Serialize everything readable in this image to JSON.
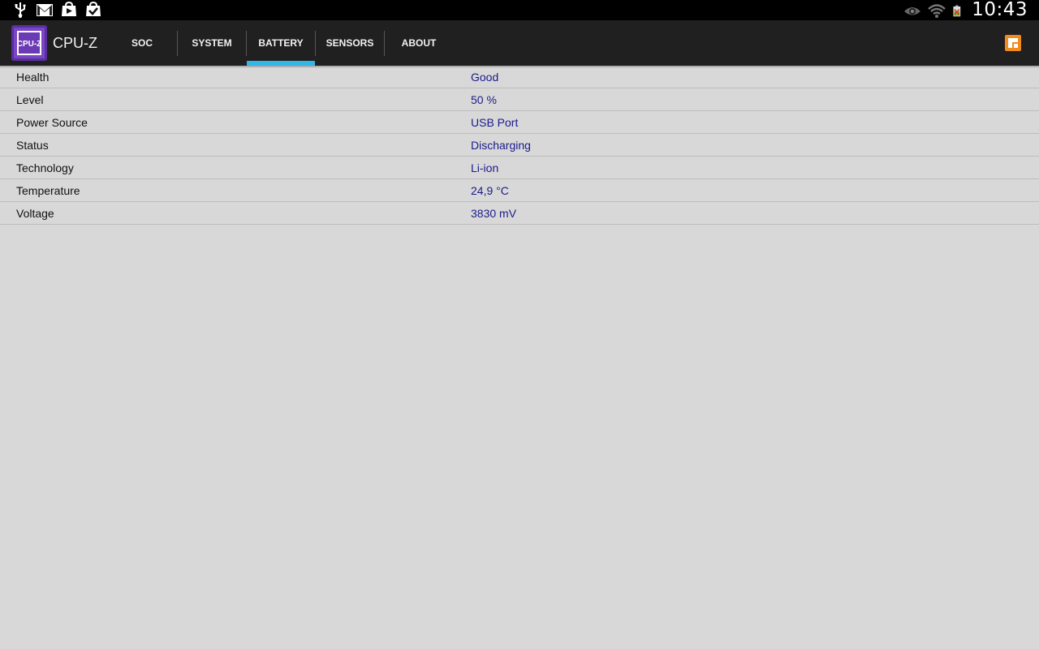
{
  "status_bar": {
    "left_icons": [
      "usb-icon",
      "gmail-icon",
      "play-store-icon",
      "task-icon"
    ],
    "right_icons": [
      "eye-icon",
      "wifi-icon",
      "battery-icon"
    ],
    "time": "10:43"
  },
  "action_bar": {
    "app_icon": "cpu-z-logo",
    "app_logo_text": "CPU-Z",
    "app_title": "CPU-Z",
    "tabs": [
      {
        "label": "SOC",
        "active": false
      },
      {
        "label": "SYSTEM",
        "active": false
      },
      {
        "label": "BATTERY",
        "active": true
      },
      {
        "label": "SENSORS",
        "active": false
      },
      {
        "label": "ABOUT",
        "active": false
      }
    ],
    "accent_color": "#33b5e5",
    "menu_icon": "overflow-menu-icon"
  },
  "battery": {
    "rows": [
      {
        "label": "Health",
        "value": "Good"
      },
      {
        "label": "Level",
        "value": "50 %"
      },
      {
        "label": "Power Source",
        "value": "USB Port"
      },
      {
        "label": "Status",
        "value": "Discharging"
      },
      {
        "label": "Technology",
        "value": "Li-ion"
      },
      {
        "label": "Temperature",
        "value": "24,9 °C"
      },
      {
        "label": "Voltage",
        "value": "3830 mV"
      }
    ]
  }
}
